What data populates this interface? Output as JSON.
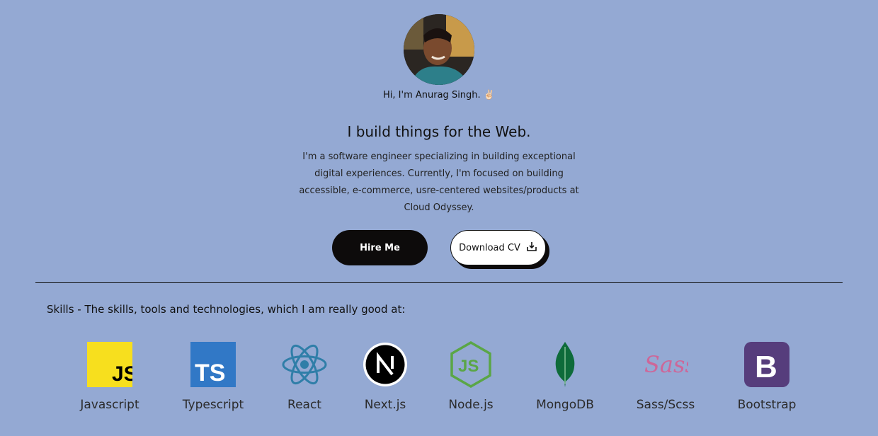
{
  "hero": {
    "greeting": "Hi, I'm Anurag Singh. ✌🏻",
    "headline": "I build things for the Web.",
    "intro": "I'm a software engineer specializing in building exceptional digital experiences. Currently, I'm focused on building accessible, e-commerce, usre-centered websites/products at Cloud Odyssey.",
    "hire_label": "Hire Me",
    "cv_label": "Download CV"
  },
  "skills": {
    "heading": "Skills - The skills, tools and technologies, which I am really good at:",
    "items": [
      {
        "label": "Javascript",
        "icon": "javascript-icon"
      },
      {
        "label": "Typescript",
        "icon": "typescript-icon"
      },
      {
        "label": "React",
        "icon": "react-icon"
      },
      {
        "label": "Next.js",
        "icon": "nextjs-icon"
      },
      {
        "label": "Node.js",
        "icon": "nodejs-icon"
      },
      {
        "label": "MongoDB",
        "icon": "mongodb-icon"
      },
      {
        "label": "Sass/Scss",
        "icon": "sass-icon"
      },
      {
        "label": "Bootstrap",
        "icon": "bootstrap-icon"
      }
    ]
  },
  "colors": {
    "background": "#94a9d3",
    "button_dark": "#0d0b0b",
    "js_yellow": "#f7df1e",
    "ts_blue": "#3178c6",
    "react_blue": "#2f7ea8",
    "node_green": "#5aa646",
    "mongo_green": "#0e6b3a",
    "sass_pink": "#cd6799",
    "bootstrap_purple": "#563d7c"
  }
}
